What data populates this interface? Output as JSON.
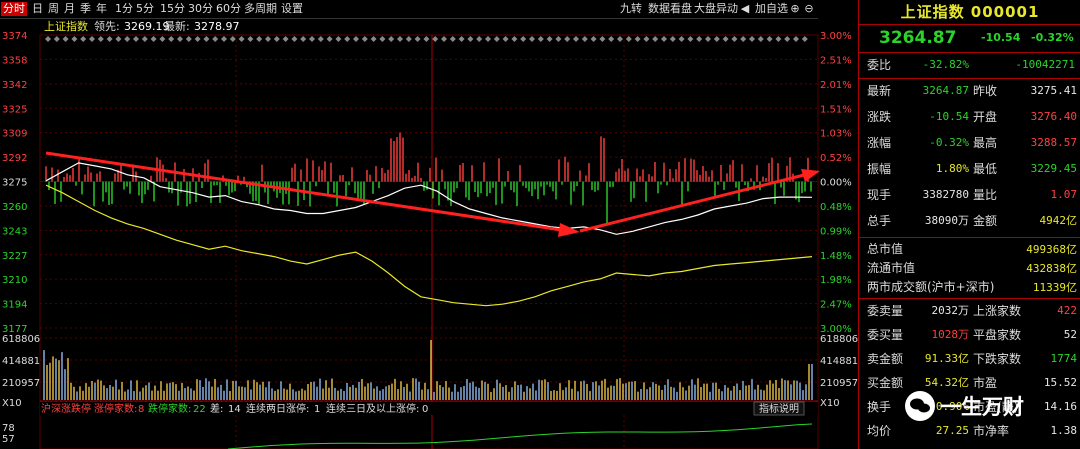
{
  "toolbar": {
    "tabs": [
      "分时",
      "日",
      "周",
      "月",
      "季",
      "年",
      "1分",
      "5分",
      "15分",
      "30分",
      "60分",
      "多周期",
      "设置"
    ],
    "active_tab": 0,
    "right_items": [
      "九转",
      "数据看盘",
      "大盘异动",
      "加自选"
    ]
  },
  "chart_header": {
    "index_name": "上证指数",
    "leader_label": "领先:",
    "leader_value": "3269.19",
    "latest_label": "最新:",
    "latest_value": "3278.97"
  },
  "chart_data": {
    "type": "line",
    "price_axis_labels": [
      "3374",
      "3358",
      "3342",
      "3325",
      "3309",
      "3292",
      "3275",
      "3260",
      "3243",
      "3227",
      "3210",
      "3194",
      "3177"
    ],
    "pct_axis_labels": [
      "3.00%",
      "2.51%",
      "2.01%",
      "1.51%",
      "1.03%",
      "0.52%",
      "0.00%",
      "0.48%",
      "0.99%",
      "1.48%",
      "1.98%",
      "2.47%",
      "3.00%"
    ],
    "volume_axis_labels": [
      "618806",
      "414881",
      "210957",
      "X10"
    ],
    "breadth_axis_labels": [
      "78",
      "57"
    ],
    "prev_close": 3275.41,
    "ylim": [
      3177,
      3374
    ],
    "series": [
      {
        "name": "white_price",
        "values": [
          3276,
          3282,
          3288,
          3286,
          3284,
          3280,
          3278,
          3272,
          3270,
          3268,
          3265,
          3266,
          3262,
          3260,
          3257,
          3256,
          3254,
          3254,
          3256,
          3258,
          3262,
          3266,
          3271,
          3273,
          3269,
          3262,
          3257,
          3254,
          3251,
          3249,
          3247,
          3245,
          3244,
          3245,
          3243,
          3240,
          3242,
          3245,
          3248,
          3250,
          3253,
          3257,
          3259,
          3261,
          3264,
          3265,
          3265,
          3264.87
        ]
      },
      {
        "name": "yellow_avg",
        "values": [
          3273,
          3268,
          3262,
          3256,
          3251,
          3247,
          3244,
          3240,
          3236,
          3233,
          3230,
          3232,
          3229,
          3227,
          3225,
          3222,
          3220,
          3223,
          3226,
          3228,
          3222,
          3214,
          3205,
          3198,
          3196,
          3194,
          3193,
          3192,
          3193,
          3195,
          3198,
          3202,
          3205,
          3208,
          3210,
          3214,
          3213,
          3212,
          3214,
          3215,
          3217,
          3219,
          3220,
          3221,
          3222,
          3223,
          3224,
          3225
        ]
      }
    ]
  },
  "breadth_bar": {
    "label_sh_sz": "沪深涨跌停",
    "limit_up_label": "涨停家数:",
    "limit_up": "8",
    "limit_down_label": "跌停家数:",
    "limit_down": "22",
    "up_down_label": "差:",
    "up_down": "14",
    "two_day_label": "连续两日涨停:",
    "two_day": "1",
    "three_day_label": "连续三日及以上涨停:",
    "three_day": "0",
    "help": "指标说明"
  },
  "panel": {
    "title": "上证指数 000001",
    "price": "3264.87",
    "change": "-10.54",
    "change_pct": "-0.32%",
    "weibi_label": "委比",
    "weibi_pct": "-32.82%",
    "weibi_val": "-10042271",
    "rows1": [
      {
        "l1": "最新",
        "v1": "3264.87",
        "c1": "green",
        "l2": "昨收",
        "v2": "3275.41",
        "c2": "white"
      },
      {
        "l1": "涨跌",
        "v1": "-10.54",
        "c1": "green",
        "l2": "开盘",
        "v2": "3276.40",
        "c2": "red"
      },
      {
        "l1": "涨幅",
        "v1": "-0.32%",
        "c1": "green",
        "l2": "最高",
        "v2": "3288.57",
        "c2": "red"
      },
      {
        "l1": "振幅",
        "v1": "1.80%",
        "c1": "yellow",
        "l2": "最低",
        "v2": "3229.45",
        "c2": "green"
      },
      {
        "l1": "现手",
        "v1": "3382780",
        "c1": "white",
        "l2": "量比",
        "v2": "1.07",
        "c2": "red"
      },
      {
        "l1": "总手",
        "v1": "38090万",
        "c1": "white",
        "l2": "金额",
        "v2": "4942亿",
        "c2": "yellow"
      }
    ],
    "rows2": [
      {
        "l": "总市值",
        "v": "499368亿"
      },
      {
        "l": "流通市值",
        "v": "432838亿"
      },
      {
        "l": "两市成交额(沪市+深市)",
        "v": "11339亿"
      }
    ],
    "rows3": [
      {
        "l1": "委卖量",
        "v1": "2032万",
        "c1": "white",
        "l2": "上涨家数",
        "v2": "422",
        "c2": "red"
      },
      {
        "l1": "委买量",
        "v1": "1028万",
        "c1": "red",
        "l2": "平盘家数",
        "v2": "52",
        "c2": "white"
      },
      {
        "l1": "卖金额",
        "v1": "91.33亿",
        "c1": "yellow",
        "l2": "下跌家数",
        "v2": "1774",
        "c2": "green"
      },
      {
        "l1": "买金额",
        "v1": "54.32亿",
        "c1": "yellow",
        "l2": "市盈",
        "v2": "15.52",
        "c2": "white"
      },
      {
        "l1": "换手",
        "v1": "0.90%",
        "c1": "yellow",
        "l2": "市盈(静)",
        "v2": "14.16",
        "c2": "white"
      },
      {
        "l1": "均价",
        "v1": "27.25",
        "c1": "yellow",
        "l2": "市净率",
        "v2": "1.38",
        "c2": "white"
      }
    ]
  },
  "watermark": {
    "text": "一生万财"
  },
  "colors": {
    "up": "#ff4040",
    "down": "#2bd42b",
    "price_line": "#ffffff",
    "avg_line": "#e8e82a",
    "arrow": "#ff2020",
    "grid": "#5a0000"
  }
}
